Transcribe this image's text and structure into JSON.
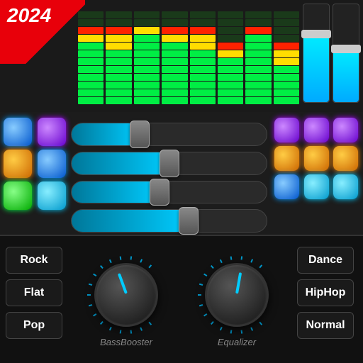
{
  "badge": {
    "year": "2024"
  },
  "visualizer": {
    "bars": [
      {
        "levels": [
          3,
          4,
          6,
          8,
          10,
          10,
          10
        ],
        "topped": 4
      },
      {
        "levels": [
          2,
          3,
          5,
          7,
          9,
          10,
          10
        ],
        "topped": 5
      },
      {
        "levels": [
          4,
          5,
          7,
          9,
          10,
          10,
          10
        ],
        "topped": 3
      },
      {
        "levels": [
          3,
          4,
          6,
          8,
          10,
          10,
          10
        ],
        "topped": 4
      },
      {
        "levels": [
          2,
          3,
          5,
          7,
          9,
          10,
          10
        ],
        "topped": 3
      },
      {
        "levels": [
          4,
          5,
          7,
          9,
          10,
          10,
          10
        ],
        "topped": 4
      }
    ]
  },
  "right_sliders": [
    {
      "fill_pct": 70
    },
    {
      "fill_pct": 55
    }
  ],
  "pads_left": [
    {
      "color": "blue"
    },
    {
      "color": "purple"
    },
    {
      "color": "orange"
    },
    {
      "color": "blue"
    },
    {
      "color": "green"
    },
    {
      "color": "cyan"
    }
  ],
  "pads_right": [
    {
      "color": "purple"
    },
    {
      "color": "purple"
    },
    {
      "color": "purple"
    },
    {
      "color": "orange"
    },
    {
      "color": "orange"
    },
    {
      "color": "blue"
    },
    {
      "color": "blue"
    },
    {
      "color": "cyan"
    },
    {
      "color": "cyan"
    }
  ],
  "faders": [
    {
      "fill_pct": 35,
      "handle_pct": 35
    },
    {
      "fill_pct": 50,
      "handle_pct": 50
    },
    {
      "fill_pct": 45,
      "handle_pct": 45
    },
    {
      "fill_pct": 60,
      "handle_pct": 60
    }
  ],
  "presets_left": [
    {
      "label": "Rock"
    },
    {
      "label": "Flat"
    },
    {
      "label": "Pop"
    }
  ],
  "presets_right": [
    {
      "label": "Dance"
    },
    {
      "label": "HipHop"
    },
    {
      "label": "Normal"
    }
  ],
  "knobs": [
    {
      "label": "BassBooster",
      "angle": -20
    },
    {
      "label": "Equalizer",
      "angle": 10
    }
  ]
}
